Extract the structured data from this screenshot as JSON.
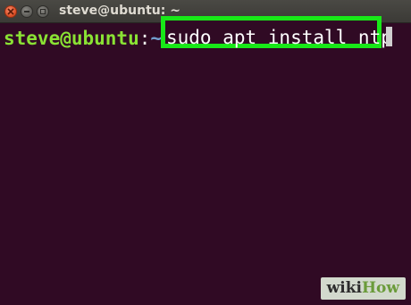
{
  "window": {
    "title": "steve@ubuntu: ~",
    "controls": [
      "close-icon",
      "minimize-icon",
      "maximize-icon"
    ]
  },
  "terminal": {
    "prompt": {
      "user_host": "steve@ubuntu",
      "separator": ":",
      "path": "~",
      "symbol": "$"
    },
    "command": "sudo apt install ntp",
    "highlight_color": "#18e818",
    "background_color": "#300a24"
  },
  "watermark": {
    "part1": "wiki",
    "part2": "How"
  }
}
